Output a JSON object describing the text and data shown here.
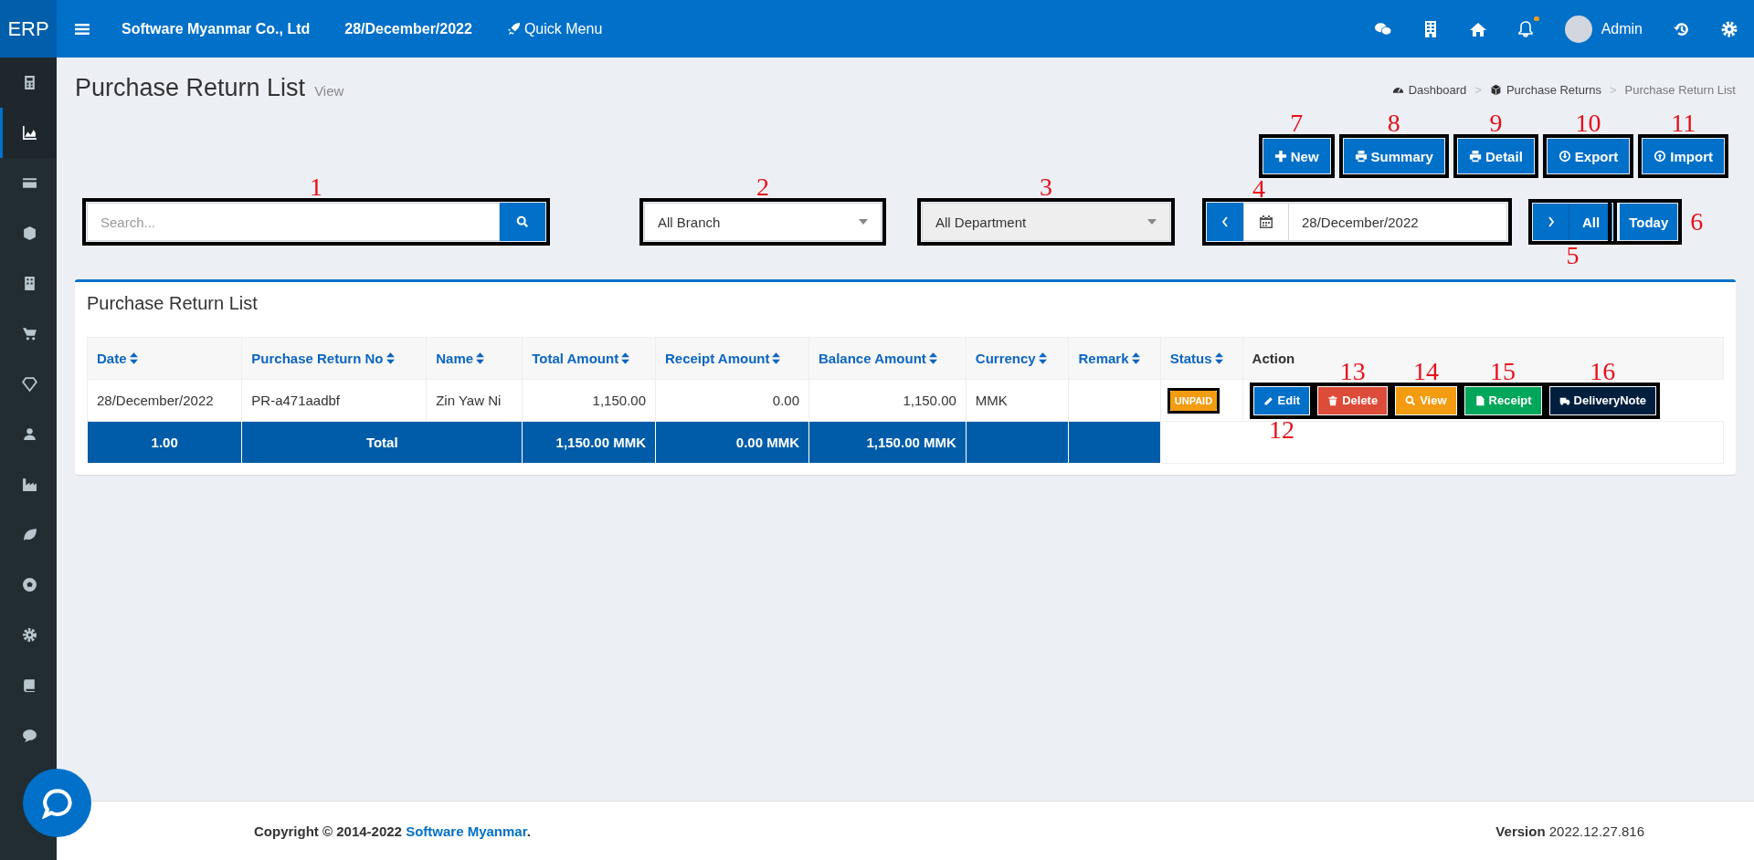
{
  "brand": "ERP",
  "topbar": {
    "company": "Software Myanmar Co., Ltd",
    "date": "28/December/2022",
    "quick_menu": "Quick Menu",
    "bell_alert": true,
    "user": "Admin"
  },
  "sidebar": {
    "items": [
      {
        "kind": "calculator",
        "selected": false
      },
      {
        "kind": "area-chart",
        "selected": true
      },
      {
        "kind": "card",
        "selected": false
      },
      {
        "kind": "cube",
        "selected": false
      },
      {
        "kind": "building",
        "selected": false
      },
      {
        "kind": "cart",
        "selected": false
      },
      {
        "kind": "diamond",
        "selected": false
      },
      {
        "kind": "users",
        "selected": false
      },
      {
        "kind": "factory",
        "selected": false
      },
      {
        "kind": "leaf",
        "selected": false
      },
      {
        "kind": "ball",
        "selected": false
      },
      {
        "kind": "gear",
        "selected": false
      },
      {
        "kind": "book",
        "selected": false
      },
      {
        "kind": "chat",
        "selected": false
      }
    ]
  },
  "page": {
    "title": "Purchase Return List",
    "subtitle": "View"
  },
  "breadcrumb": [
    {
      "kind": "dashboard",
      "label": "Dashboard"
    },
    {
      "kind": "cube",
      "separator": ">",
      "label": "Purchase Returns"
    },
    {
      "kind": "none",
      "separator": ">",
      "label": "Purchase Return List"
    }
  ],
  "toolbar_buttons": [
    {
      "kind": "plus",
      "label": "New",
      "callout": {
        "number": "7",
        "kind": "above"
      }
    },
    {
      "kind": "print",
      "label": "Summary",
      "callout": {
        "number": "8",
        "kind": "above"
      }
    },
    {
      "kind": "print",
      "label": "Detail",
      "callout": {
        "number": "9",
        "kind": "above"
      }
    },
    {
      "kind": "download",
      "label": "Export",
      "callout": {
        "number": "10",
        "kind": "above"
      }
    },
    {
      "kind": "upload",
      "label": "Import",
      "callout": {
        "number": "11",
        "kind": "above"
      }
    }
  ],
  "filters": {
    "search": {
      "placeholder": "Search...",
      "callout": {
        "number": "1",
        "kind": "above"
      }
    },
    "branch": {
      "value": "All Branch",
      "disabled": false,
      "callout": {
        "number": "2",
        "kind": "above"
      }
    },
    "department": {
      "value": "All Department",
      "disabled": true,
      "callout": {
        "number": "3",
        "kind": "above"
      }
    },
    "date": {
      "value": "28/December/2022",
      "callout": {
        "number": "4",
        "kind": "above-left"
      }
    },
    "all": {
      "label": "All",
      "callout": {
        "number": "5",
        "kind": "below"
      }
    },
    "today": {
      "label": "Today",
      "callout": {
        "number": "6",
        "kind": "right"
      }
    }
  },
  "panel": {
    "title": "Purchase Return List"
  },
  "table": {
    "columns": [
      {
        "label": "Date",
        "sortable": true
      },
      {
        "label": "Purchase Return No",
        "sortable": true
      },
      {
        "label": "Name",
        "sortable": true
      },
      {
        "label": "Total Amount",
        "sortable": true
      },
      {
        "label": "Receipt Amount",
        "sortable": true
      },
      {
        "label": "Balance Amount",
        "sortable": true
      },
      {
        "label": "Currency",
        "sortable": true
      },
      {
        "label": "Remark",
        "sortable": true
      },
      {
        "label": "Status",
        "sortable": true
      },
      {
        "label": "Action",
        "sortable": false
      }
    ],
    "rows": [
      {
        "date": "28/December/2022",
        "number": "PR-a471aadbf",
        "name": "Zin Yaw Ni",
        "total": "1,150.00",
        "receipt": "0.00",
        "balance": "1,150.00",
        "currency": "MMK",
        "status": {
          "label": "UNPAID",
          "kind": "unpaid",
          "framed": true
        },
        "actions": [
          {
            "kind": "edit",
            "label": "Edit",
            "callout": {
              "number": "12",
              "kind": "below"
            }
          },
          {
            "kind": "delete",
            "label": "Delete",
            "callout": {
              "number": "13",
              "kind": "above"
            }
          },
          {
            "kind": "view",
            "label": "View",
            "callout": {
              "number": "14",
              "kind": "above"
            }
          },
          {
            "kind": "receipt",
            "label": "Receipt",
            "callout": {
              "number": "15",
              "kind": "above"
            }
          },
          {
            "kind": "delivery",
            "label": "DeliveryNote",
            "callout": {
              "number": "16",
              "kind": "above"
            }
          }
        ]
      }
    ],
    "totals": [
      {
        "kind": "label",
        "text": "1.00",
        "wide": false
      },
      {
        "kind": "label",
        "text": "Total",
        "wide": true
      },
      {
        "kind": "amount",
        "text": "1,150.00 MMK",
        "wide": false
      },
      {
        "kind": "amount",
        "text": "0.00 MMK",
        "wide": false
      },
      {
        "kind": "amount",
        "text": "1,150.00 MMK",
        "wide": false
      },
      {
        "kind": "blank"
      },
      {
        "kind": "blank"
      }
    ]
  },
  "footer": {
    "copyright": "Copyright © 2014-2022 ",
    "company_link": "Software Myanmar",
    "period": ".",
    "version_label": "Version",
    "version": "2022.12.27.816"
  }
}
